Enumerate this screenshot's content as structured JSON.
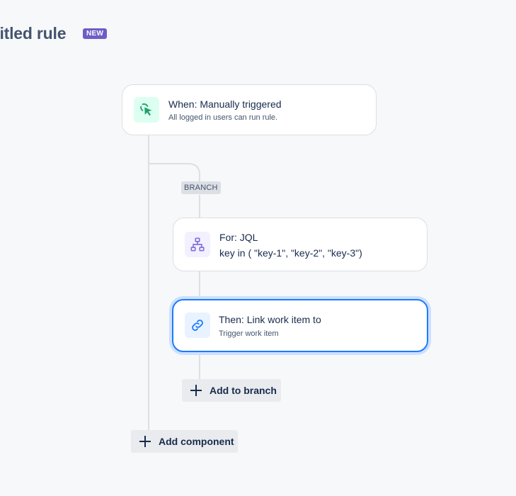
{
  "header": {
    "title": "titled rule",
    "badge": "NEW"
  },
  "trigger": {
    "title": "When: Manually triggered",
    "subtitle": "All logged in users can run rule.",
    "icon": "cursor-click-icon"
  },
  "branch": {
    "label": "BRANCH"
  },
  "branch_rule": {
    "title": "For: JQL",
    "subtitle": "key in ( \"key-1\", \"key-2\", \"key-3\")",
    "icon": "hierarchy-icon"
  },
  "action": {
    "title": "Then: Link work item to",
    "subtitle": "Trigger work item",
    "icon": "link-icon"
  },
  "buttons": {
    "add_to_branch": "Add to branch",
    "add_component": "Add component"
  },
  "colors": {
    "accent": "#1d7afc",
    "badge": "#6e5dc6",
    "trigger_icon": "#22a06b",
    "branch_icon": "#8270db"
  }
}
